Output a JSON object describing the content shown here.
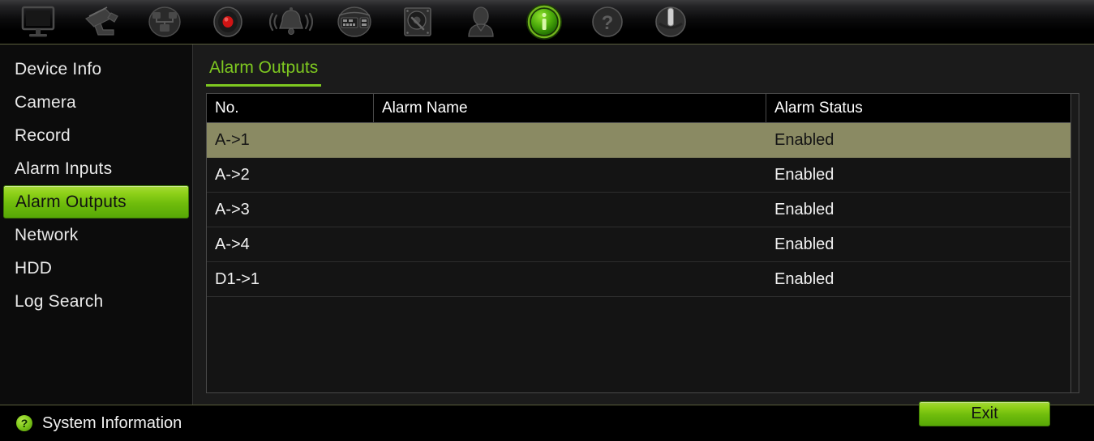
{
  "toolbar": {
    "items": [
      {
        "name": "monitor-icon",
        "label": "Display",
        "active": false
      },
      {
        "name": "camera-icon",
        "label": "Camera",
        "active": false
      },
      {
        "name": "playback-icon",
        "label": "Playback",
        "active": false
      },
      {
        "name": "record-icon",
        "label": "Record",
        "active": false
      },
      {
        "name": "alarm-bell-icon",
        "label": "Alarm",
        "active": false
      },
      {
        "name": "export-icon",
        "label": "Export",
        "active": false
      },
      {
        "name": "hdd-icon",
        "label": "HDD",
        "active": false
      },
      {
        "name": "user-icon",
        "label": "User",
        "active": false
      },
      {
        "name": "info-icon",
        "label": "System Information",
        "active": true
      },
      {
        "name": "help-icon",
        "label": "Help",
        "active": false
      },
      {
        "name": "shutdown-icon",
        "label": "Shutdown",
        "active": false
      }
    ]
  },
  "sidebar": {
    "items": [
      {
        "label": "Device Info",
        "active": false
      },
      {
        "label": "Camera",
        "active": false
      },
      {
        "label": "Record",
        "active": false
      },
      {
        "label": "Alarm Inputs",
        "active": false
      },
      {
        "label": "Alarm Outputs",
        "active": true
      },
      {
        "label": "Network",
        "active": false
      },
      {
        "label": "HDD",
        "active": false
      },
      {
        "label": "Log Search",
        "active": false
      }
    ]
  },
  "content": {
    "tab_label": "Alarm Outputs",
    "table": {
      "columns": [
        "No.",
        "Alarm Name",
        "Alarm Status"
      ],
      "rows": [
        {
          "no": "A->1",
          "alarm_name": "",
          "alarm_status": "Enabled",
          "selected": true
        },
        {
          "no": "A->2",
          "alarm_name": "",
          "alarm_status": "Enabled",
          "selected": false
        },
        {
          "no": "A->3",
          "alarm_name": "",
          "alarm_status": "Enabled",
          "selected": false
        },
        {
          "no": "A->4",
          "alarm_name": "",
          "alarm_status": "Enabled",
          "selected": false
        },
        {
          "no": "D1->1",
          "alarm_name": "",
          "alarm_status": "Enabled",
          "selected": false
        }
      ]
    },
    "exit_label": "Exit"
  },
  "statusbar": {
    "icon_glyph": "?",
    "text": "System Information"
  },
  "colors": {
    "accent_green": "#7ec820",
    "selected_row": "#8a8a63",
    "panel_bg": "#1b1b1b",
    "sidebar_bg": "#0c0c0c"
  }
}
